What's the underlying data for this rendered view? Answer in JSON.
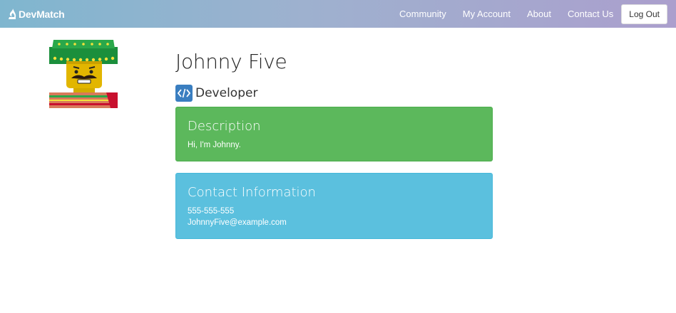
{
  "navbar": {
    "brand": "DevMatch",
    "links": [
      "Community",
      "My Account",
      "About",
      "Contact Us"
    ],
    "logout_label": "Log Out"
  },
  "profile": {
    "name": "Johnny Five",
    "role": "Developer"
  },
  "panels": {
    "description": {
      "title": "Description",
      "text": "Hi, I'm Johnny."
    },
    "contact": {
      "title": "Contact Information",
      "phone": "555-555-555",
      "email": "JohnnyFive@example.com"
    }
  },
  "colors": {
    "navbar_left": "#7fb6cf",
    "navbar_right": "#ab9fcd",
    "description_panel": "#5cb85c",
    "contact_panel": "#5bc0de",
    "role_icon": "#3a7ec0"
  },
  "icons": {
    "brand": "flame-icon",
    "role": "code-icon"
  }
}
